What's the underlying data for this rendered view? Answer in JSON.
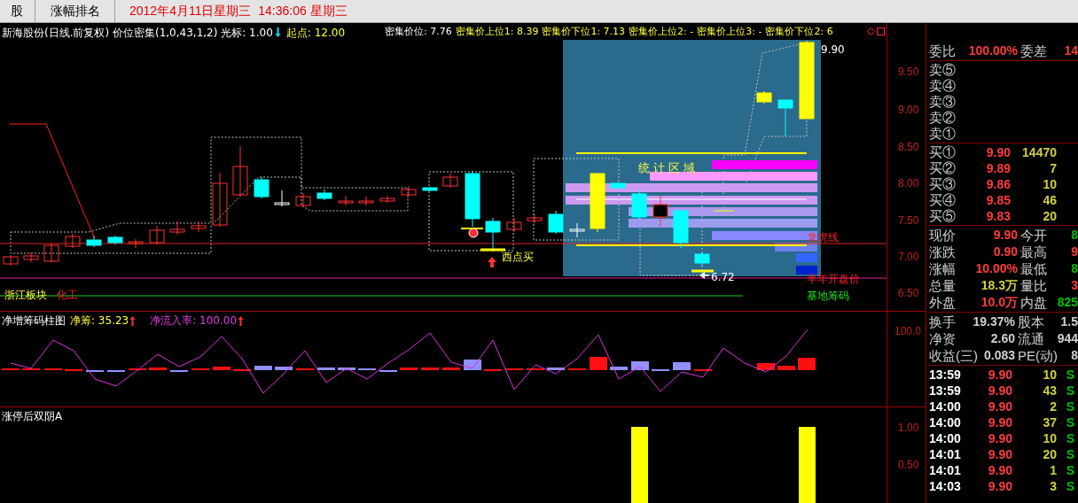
{
  "top_bar": {
    "tabs": [
      {
        "label": "股",
        "selected": false
      },
      {
        "label": "涨幅排名",
        "selected": false
      }
    ],
    "datetime": "2012年4月11日星期三  14:36:06 星期三"
  },
  "main_chart": {
    "title": "新海股份(日线.前复权) 价位密集(1,0,43,1,2) 光标: 1.00",
    "start_point": "起点: 12.00",
    "density_price": "密集价位: 7.76",
    "readouts": [
      "密集价上位1: 8.39",
      "密集价下位1: 7.13",
      "密集价上位2: -",
      "密集价上位3: -",
      "密集价下位2: 6"
    ],
    "y_ticks": [
      "9.50",
      "9.00",
      "8.50",
      "8.00",
      "7.50",
      "7.00",
      "6.50"
    ],
    "high_label": "9.90",
    "low_label": "6.72",
    "stat_zone_label": "统 计 区 域",
    "dragon_tiger_label": "龙虎线",
    "half_year_open_label": "半年开盘价",
    "base_chips_label": "基地筹码",
    "sector_label": "浙江板块",
    "industry_label": "化工",
    "buy_signal_label": "西点买"
  },
  "chip_panel": {
    "title": "净增筹码柱图",
    "net_chips": "净筹: 35.23",
    "net_inflow": "净流入率: 100.00",
    "y_ticks": [
      "100.0"
    ]
  },
  "limit_panel": {
    "title": "涨停后双阴A",
    "y_ticks": [
      "1.00",
      "0.50"
    ]
  },
  "quote_panel": {
    "order_ratio": {
      "label": "委比",
      "value": "100.00%",
      "label2": "委差",
      "value2": "14"
    },
    "asks": [
      {
        "label": "卖⑤"
      },
      {
        "label": "卖④"
      },
      {
        "label": "卖③"
      },
      {
        "label": "卖②"
      },
      {
        "label": "卖①"
      }
    ],
    "bids": [
      {
        "label": "买①",
        "price": "9.90",
        "volume": "14470"
      },
      {
        "label": "买②",
        "price": "9.89",
        "volume": "7"
      },
      {
        "label": "买③",
        "price": "9.86",
        "volume": "10"
      },
      {
        "label": "买④",
        "price": "9.85",
        "volume": "46"
      },
      {
        "label": "买⑤",
        "price": "9.83",
        "volume": "20"
      }
    ],
    "quotes": [
      {
        "left": {
          "label": "现价",
          "value": "9.90",
          "color": "#ff3c3c"
        },
        "right": {
          "label": "今开",
          "value": "8",
          "color": "#00c000"
        }
      },
      {
        "left": {
          "label": "涨跌",
          "value": "0.90",
          "color": "#ff3c3c"
        },
        "right": {
          "label": "最高",
          "value": "9",
          "color": "#ff3c3c"
        }
      },
      {
        "left": {
          "label": "涨幅",
          "value": "10.00%",
          "color": "#ff3c3c"
        },
        "right": {
          "label": "最低",
          "value": "8",
          "color": "#00c000"
        }
      },
      {
        "left": {
          "label": "总量",
          "value": "18.3万",
          "color": "#d0d040"
        },
        "right": {
          "label": "量比",
          "value": "3",
          "color": "#ff3c3c"
        }
      },
      {
        "left": {
          "label": "外盘",
          "value": "10.0万",
          "color": "#ff3c3c"
        },
        "right": {
          "label": "内盘",
          "value": "825",
          "color": "#00c000"
        }
      }
    ],
    "fundamentals": [
      {
        "label": "换手",
        "value": "19.37%",
        "label2": "股本",
        "value2": "1.5"
      },
      {
        "label": "净资",
        "value": "2.60",
        "label2": "流通",
        "value2": "944"
      },
      {
        "label": "收益(三)",
        "value": "0.083",
        "label2": "PE(动)",
        "value2": "8"
      }
    ],
    "trades": [
      {
        "time": "13:59",
        "price": "9.90",
        "volume": "10",
        "side": "S"
      },
      {
        "time": "13:59",
        "price": "9.90",
        "volume": "43",
        "side": "S"
      },
      {
        "time": "14:00",
        "price": "9.90",
        "volume": "2",
        "side": "S"
      },
      {
        "time": "14:00",
        "price": "9.90",
        "volume": "37",
        "side": "S"
      },
      {
        "time": "14:00",
        "price": "9.90",
        "volume": "10",
        "side": "S"
      },
      {
        "time": "14:01",
        "price": "9.90",
        "volume": "20",
        "side": "S"
      },
      {
        "time": "14:01",
        "price": "9.90",
        "volume": "1",
        "side": "S"
      },
      {
        "time": "14:03",
        "price": "9.90",
        "volume": "3",
        "side": "S"
      }
    ]
  }
}
